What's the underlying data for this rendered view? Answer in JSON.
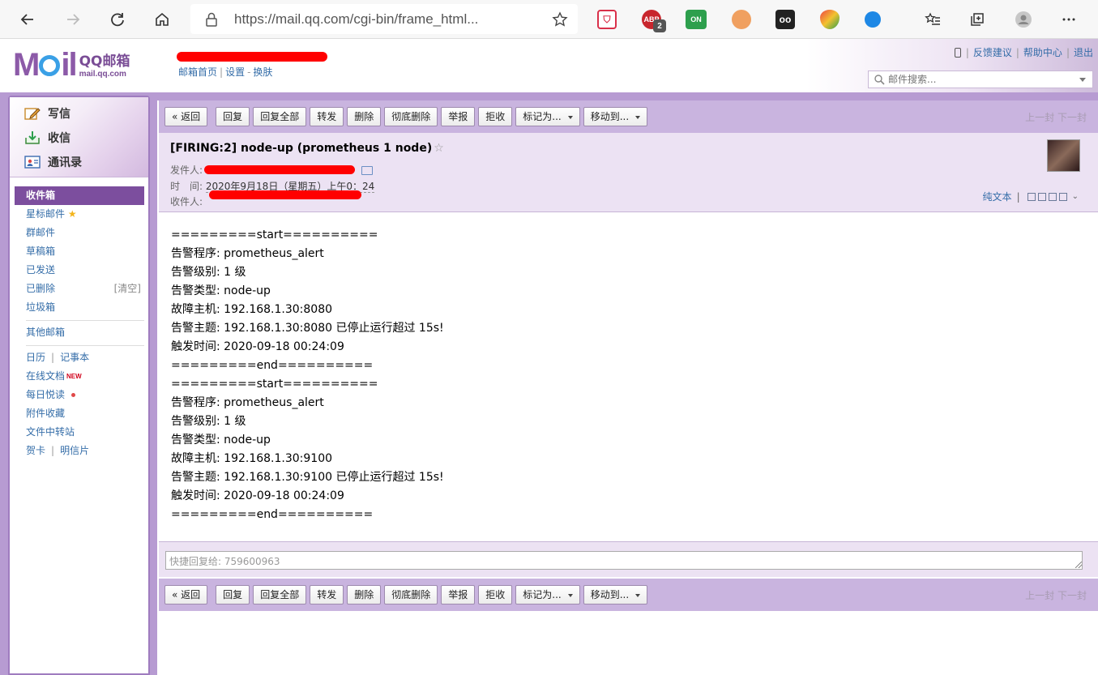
{
  "browser": {
    "url": "https://mail.qq.com/cgi-bin/frame_html...",
    "extensions": [
      {
        "name": "pocket-extension-icon",
        "label": "",
        "color": "#d9304a"
      },
      {
        "name": "adblock-extension-icon",
        "label": "ABP",
        "badge": "2",
        "color": "#c8262d"
      },
      {
        "name": "on-extension-icon",
        "label": "ON",
        "color": "#2d9f4d"
      },
      {
        "name": "translate-extension-icon",
        "label": "",
        "color": "#f0a060"
      },
      {
        "name": "glasses-extension-icon",
        "label": "",
        "color": "#222222"
      },
      {
        "name": "shield-extension-icon",
        "label": "",
        "color": "#f3c22f"
      },
      {
        "name": "cloud-extension-icon",
        "label": "",
        "color": "#1e88e5"
      }
    ]
  },
  "header": {
    "logo_text": "QQ邮箱",
    "logo_sub": "mail.qq.com",
    "account": "",
    "links": {
      "home": "邮箱首页",
      "settings": "设置",
      "skin": "换肤"
    },
    "top_links": {
      "feedback": "反馈建议",
      "help": "帮助中心",
      "logout": "退出"
    },
    "search": {
      "placeholder": "邮件搜索..."
    }
  },
  "sidebar": {
    "quick": {
      "compose": "写信",
      "inbox": "收信",
      "contacts": "通讯录"
    },
    "folders": {
      "inbox": "收件箱",
      "starred": "星标邮件",
      "group": "群邮件",
      "drafts": "草稿箱",
      "sent": "已发送",
      "deleted": "已删除",
      "clear": "[清空]",
      "spam": "垃圾箱",
      "other": "其他邮箱",
      "calendar": "日历",
      "notes": "记事本",
      "docs": "在线文档",
      "new_tag": "NEW",
      "daily": "每日悦读",
      "attachments": "附件收藏",
      "transfer": "文件中转站",
      "greeting": "贺卡",
      "postcard": "明信片"
    }
  },
  "toolbar": {
    "back": "« 返回",
    "reply": "回复",
    "reply_all": "回复全部",
    "forward": "转发",
    "delete": "删除",
    "delete_perm": "彻底删除",
    "report": "举报",
    "reject": "拒收",
    "mark_as": "标记为...",
    "move_to": "移动到...",
    "prev": "上一封",
    "next": "下一封"
  },
  "message": {
    "subject": "[FIRING:2] node-up (prometheus 1 node)",
    "from_label": "发件人:",
    "time_label": "时　间:",
    "time_value": "2020年9月18日（星期五）上午0：24",
    "to_label": "收件人:",
    "to_value": "",
    "plain_text": "纯文本",
    "body_lines": [
      "=========start==========",
      "告警程序: prometheus_alert",
      "告警级别: 1 级",
      "告警类型: node-up",
      "故障主机: 192.168.1.30:8080",
      "告警主题: 192.168.1.30:8080 已停止运行超过 15s!",
      "触发时间: 2020-09-18 00:24:09",
      "=========end==========",
      "=========start==========",
      "告警程序: prometheus_alert",
      "告警级别: 1 级",
      "告警类型: node-up",
      "故障主机: 192.168.1.30:9100",
      "告警主题: 192.168.1.30:9100 已停止运行超过 15s!",
      "触发时间: 2020-09-18 00:24:09",
      "=========end=========="
    ]
  },
  "quick_reply": {
    "placeholder": "快捷回复给: 759600963"
  }
}
